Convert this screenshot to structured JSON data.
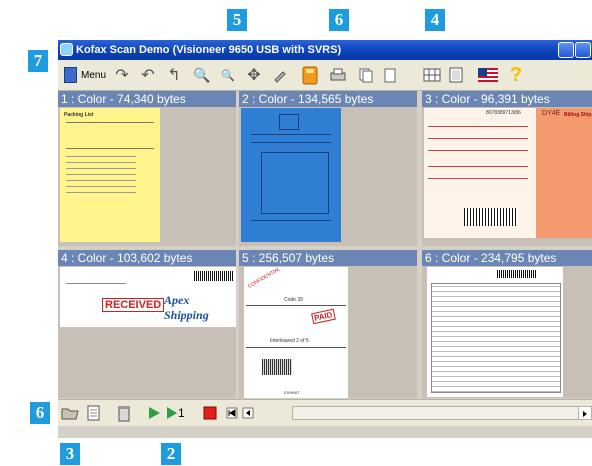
{
  "window": {
    "title": "Kofax Scan Demo (Visioneer 9650 USB with SVRS)"
  },
  "callouts": {
    "c7": "7",
    "c5": "5",
    "c6_top": "6",
    "c4": "4",
    "c6_bottom": "6",
    "c3": "3",
    "c2": "2"
  },
  "toolbar": {
    "menu_label": "Menu",
    "forward_symbol": "↷",
    "rotate_symbol": "↶",
    "back_symbol": "↰",
    "zoom_in_symbol": "🔍",
    "zoom_out_symbol": "🔍",
    "move_symbol": "✥",
    "help_symbol": "?"
  },
  "panels": [
    {
      "caption": "1 : Color - 74,340 bytes"
    },
    {
      "caption": "2 : Color - 134,565 bytes"
    },
    {
      "caption": "3 : Color - 96,391 bytes"
    },
    {
      "caption": "4 : Color - 103,602 bytes"
    },
    {
      "caption": "5 : 256,507 bytes"
    },
    {
      "caption": "6 : Color - 234,795 bytes"
    }
  ],
  "thumbnails": {
    "t1_heading": "Packing List",
    "t3_number": "8078389713/86",
    "t3_code": "DY4E",
    "t3_tag": "Billing Ship",
    "t4_received": "RECEIVED",
    "t4_company": "Apex Shipping",
    "t5_stamp1": "CONFIDENTIAL",
    "t5_stamp2": "PAID",
    "t5_code": "Code 39",
    "t5_caption": "Interleaved 2 of 5",
    "t5_bottom": "EXHIBIT"
  },
  "bottombar": {
    "step_label": "1"
  },
  "colors": {
    "title_bar": "#0a3fb8",
    "caption_bar": "#6b86b5",
    "callout": "#1f9be0",
    "stop": "#e0201a",
    "play": "#2ea043"
  }
}
